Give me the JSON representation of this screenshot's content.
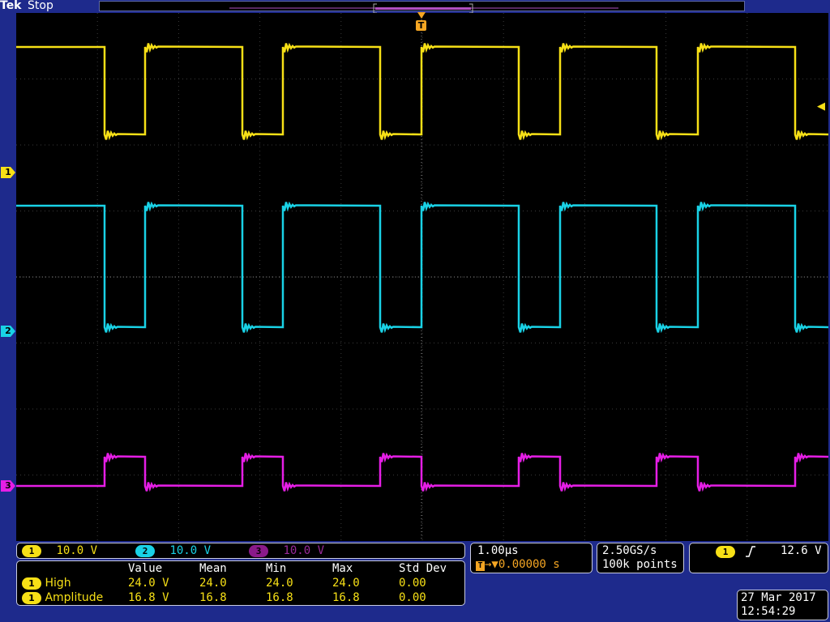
{
  "header": {
    "brand": "Tek",
    "status": "Stop"
  },
  "colors": {
    "ch1": "#f7e016",
    "ch2": "#19d2e6",
    "ch3": "#e61ee6",
    "trigger": "#f5a623",
    "background": "#000000",
    "frame": "#1e2a8c"
  },
  "channels": [
    {
      "id": "1",
      "scale": "10.0 V"
    },
    {
      "id": "2",
      "scale": "10.0 V"
    },
    {
      "id": "3",
      "scale": "10.0 V"
    }
  ],
  "trigger_marker": "T",
  "measurements": {
    "headers": [
      "Value",
      "Mean",
      "Min",
      "Max",
      "Std Dev"
    ],
    "rows": [
      {
        "channel": "1",
        "name": "High",
        "value": "24.0 V",
        "mean": "24.0",
        "min": "24.0",
        "max": "24.0",
        "std": "0.00"
      },
      {
        "channel": "1",
        "name": "Amplitude",
        "value": "16.8 V",
        "mean": "16.8",
        "min": "16.8",
        "max": "16.8",
        "std": "0.00"
      }
    ]
  },
  "horizontal": {
    "scale": "1.00µs",
    "position": "0.00000 s"
  },
  "acquisition": {
    "rate": "2.50GS/s",
    "points": "100k points"
  },
  "trigger": {
    "source": "1",
    "slope_icon": "rising-edge-icon",
    "level": "12.6 V"
  },
  "datetime": {
    "date": "27 Mar 2017",
    "time": "12:54:29"
  }
}
